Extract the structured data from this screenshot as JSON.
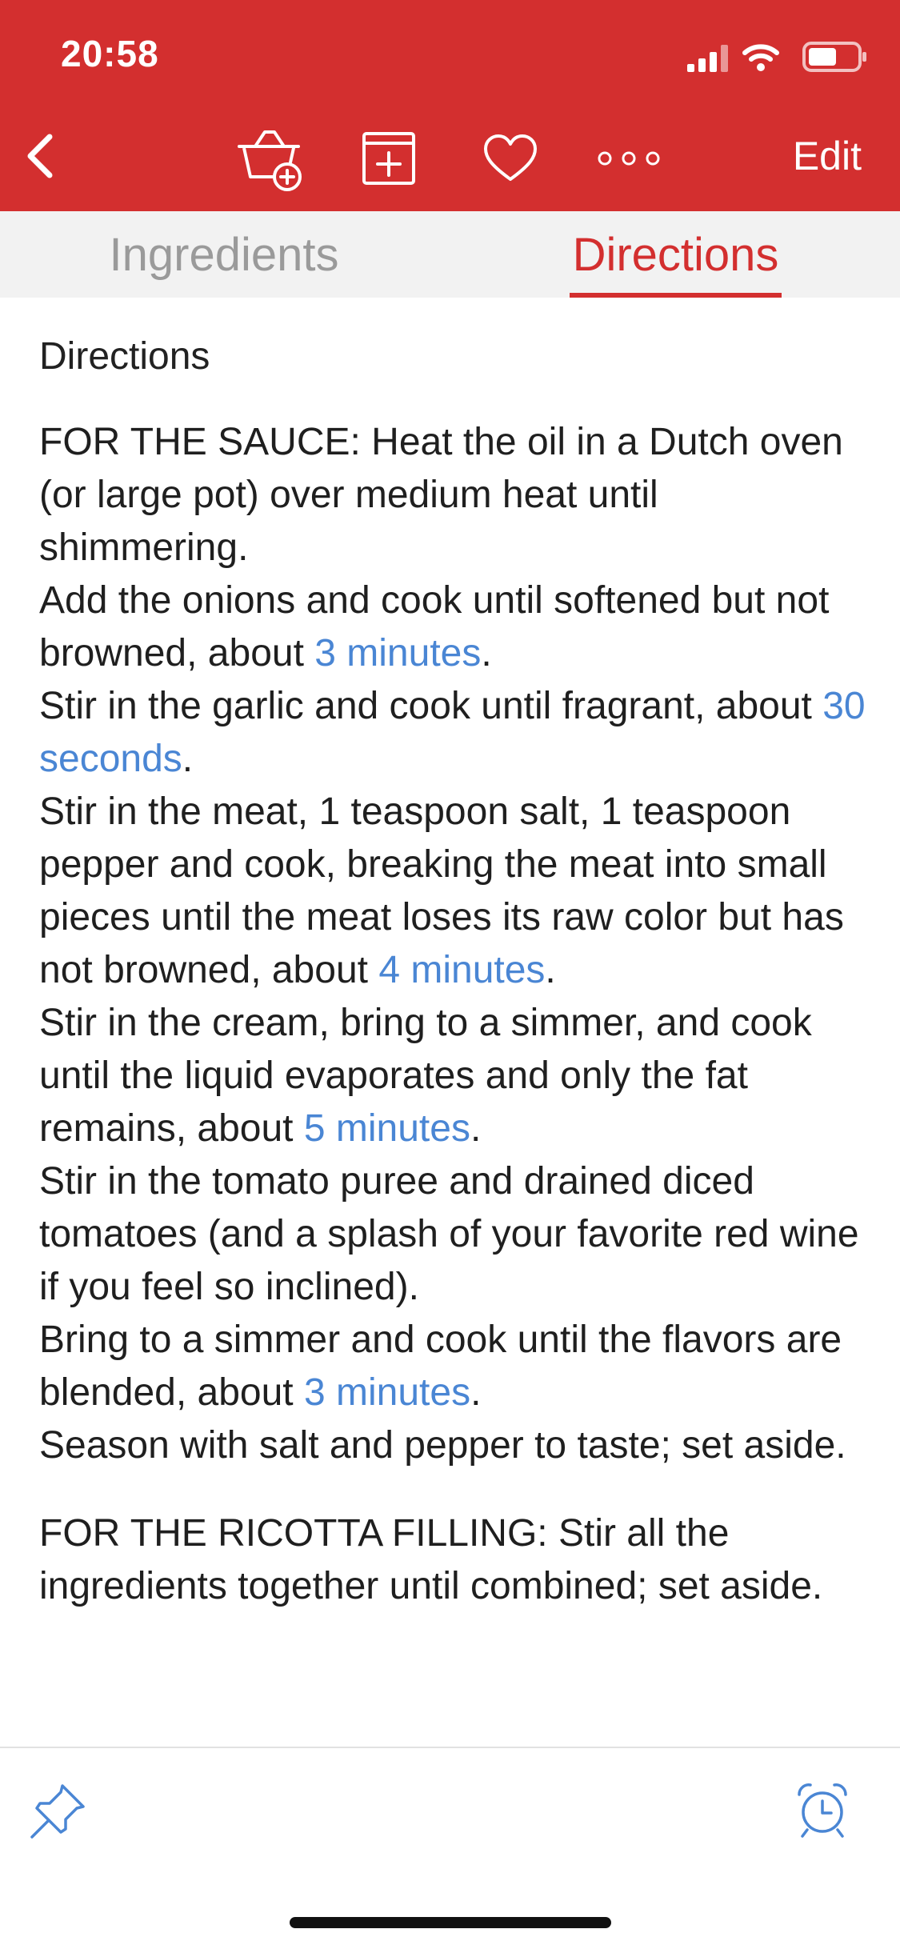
{
  "status_bar": {
    "time": "20:58"
  },
  "toolbar": {
    "back_icon": "chevron-left-icon",
    "icons": [
      "basket-add-icon",
      "calendar-add-icon",
      "heart-icon",
      "more-icon"
    ],
    "edit_label": "Edit",
    "accent_color": "#d32f2f"
  },
  "tabs": [
    {
      "label": "Ingredients",
      "active": false
    },
    {
      "label": "Directions",
      "active": true
    }
  ],
  "directions": {
    "heading": "Directions",
    "sauce": [
      {
        "pre": "FOR THE SAUCE: Heat the oil in a Dutch oven (or large pot) over medium heat until shimmering.",
        "time": "",
        "post": ""
      },
      {
        "pre": "Add the onions and cook until softened but not browned, about ",
        "time": "3 minutes",
        "post": "."
      },
      {
        "pre": "Stir in the garlic and cook until fragrant, about ",
        "time": "30 seconds",
        "post": "."
      },
      {
        "pre": "Stir in the meat, 1 teaspoon salt, 1 teaspoon pepper and cook, breaking the meat into small pieces until the meat loses its raw color but has not browned, about ",
        "time": "4 minutes",
        "post": "."
      },
      {
        "pre": "Stir in the cream, bring to a simmer, and cook until the liquid evaporates and only the fat remains, about ",
        "time": "5 minutes",
        "post": "."
      },
      {
        "pre": "Stir in the tomato puree and drained diced tomatoes (and a splash of your favorite red wine if you feel so inclined).",
        "time": "",
        "post": ""
      },
      {
        "pre": "Bring to a simmer and cook until the flavors are blended, about ",
        "time": "3 minutes",
        "post": "."
      },
      {
        "pre": "Season with salt and pepper to taste; set aside.",
        "time": "",
        "post": ""
      }
    ],
    "ricotta": [
      {
        "pre": "FOR THE RICOTTA FILLING: Stir all the ingredients together until combined; set aside.",
        "time": "",
        "post": ""
      }
    ],
    "link_color": "#4a86d4"
  },
  "bottom_bar": {
    "left_icon": "pin-icon",
    "right_icon": "alarm-clock-icon",
    "icon_color": "#4a86d4"
  }
}
